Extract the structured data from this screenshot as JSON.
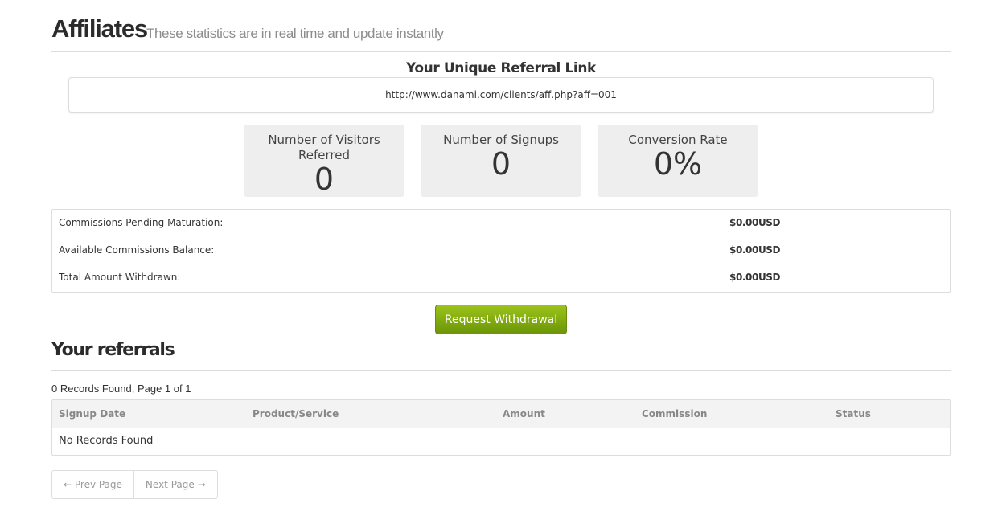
{
  "header": {
    "title": "Affiliates",
    "subtitle": "These statistics are in real time and update instantly"
  },
  "referral": {
    "title": "Your Unique Referral Link",
    "link": "http://www.danami.com/clients/aff.php?aff=001"
  },
  "stats": [
    {
      "label": "Number of Visitors Referred",
      "value": "0"
    },
    {
      "label": "Number of Signups",
      "value": "0"
    },
    {
      "label": "Conversion Rate",
      "value": "0%"
    }
  ],
  "commissions": [
    {
      "label": "Commissions Pending Maturation:",
      "value": "$0.00USD"
    },
    {
      "label": "Available Commissions Balance:",
      "value": "$0.00USD"
    },
    {
      "label": "Total Amount Withdrawn:",
      "value": "$0.00USD"
    }
  ],
  "withdraw_button": "Request Withdrawal",
  "referrals": {
    "title": "Your referrals",
    "records_info": "0 Records Found, Page 1 of 1",
    "columns": [
      "Signup Date",
      "Product/Service",
      "Amount",
      "Commission",
      "Status"
    ],
    "empty_text": "No Records Found"
  },
  "pager": {
    "prev": "← Prev Page",
    "next": "Next Page →"
  },
  "colors": {
    "button_top": "#9bc31b",
    "button_bottom": "#6c9607",
    "stat_bg": "#eeeeee",
    "table_header_bg": "#f3f3f3"
  }
}
